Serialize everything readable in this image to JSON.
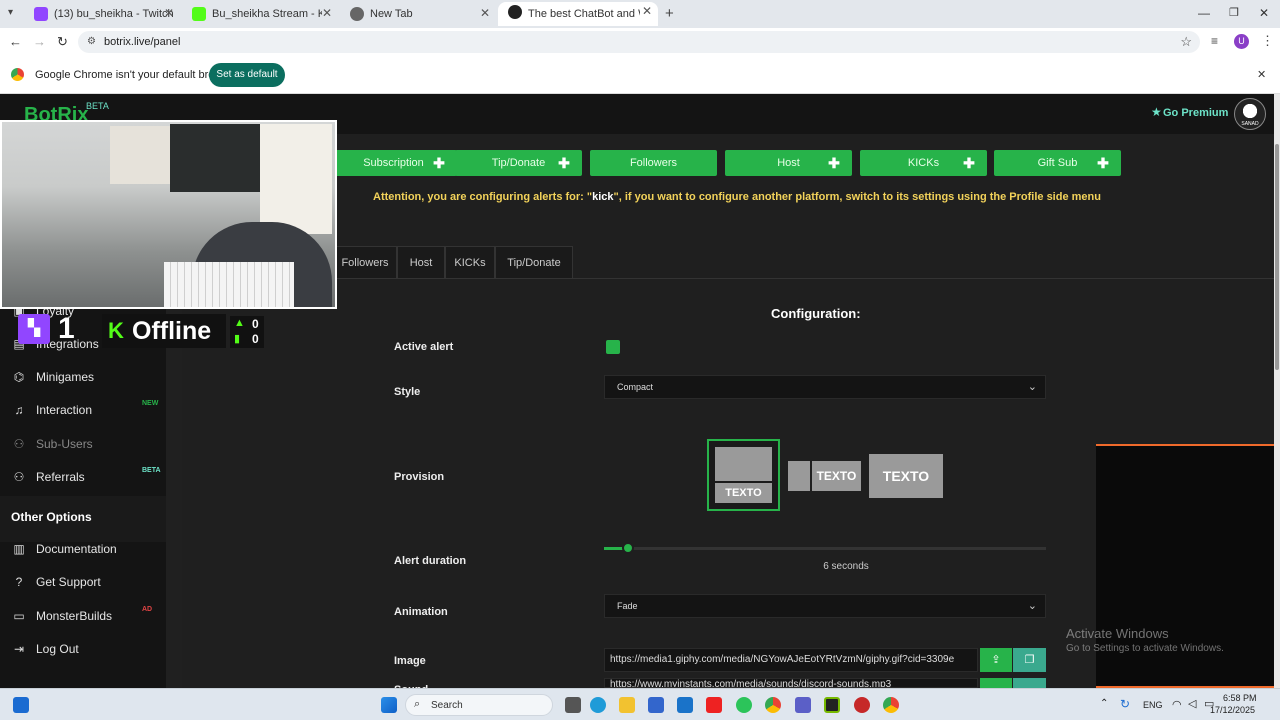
{
  "browser": {
    "tabs": [
      {
        "title": "(13) bu_sheikha - Twitch",
        "color": "#9146ff"
      },
      {
        "title": "Bu_sheikha Stream - Kick Dashb",
        "color": "#53fc18"
      },
      {
        "title": "New Tab",
        "color": "#666666"
      },
      {
        "title": "The best ChatBot and Widgets f",
        "color": "#222222"
      }
    ],
    "url": "botrix.live/panel",
    "infobar_text": "Google Chrome isn't your default browser",
    "infobar_button": "Set as default",
    "profile_initial": "U"
  },
  "app": {
    "logo": "BotRix",
    "logo_badge": "BETA",
    "premium": "Go Premium",
    "avatar_label": "SANAD",
    "alert_buttons": [
      "Subscription",
      "Tip/Donate",
      "Followers",
      "Host",
      "KICKs",
      "Gift Sub"
    ],
    "attention_prefix": "Attention, you are configuring alerts for: \"",
    "attention_platform": "kick",
    "attention_suffix": "\", if you want to configure another platform, switch to its settings using the Profile side menu",
    "subtabs": [
      "Followers",
      "Host",
      "KICKs",
      "Tip/Donate"
    ],
    "config_title": "Configuration:",
    "active_alert_label": "Active alert",
    "style_label": "Style",
    "style_value": "Compact",
    "provision_label": "Provision",
    "provision_text": "TEXTO",
    "alert_duration_label": "Alert duration",
    "alert_duration_value": "6",
    "alert_duration_unit": "seconds",
    "alert_duration_fraction": 0.04,
    "animation_label": "Animation",
    "animation_value": "Fade",
    "image_label": "Image",
    "image_url": "https://media1.giphy.com/media/NGYowAJeEotYRtVzmN/giphy.gif?cid=3309e",
    "sound_label": "Sound",
    "sound_url": "https://www.myinstants.com/media/sounds/discord-sounds.mp3"
  },
  "sidebar": {
    "partial_item": "Loyalty",
    "items": [
      {
        "label": "Integrations",
        "icon": "integrations-icon"
      },
      {
        "label": "Minigames",
        "icon": "gamepad-icon"
      },
      {
        "label": "Interaction",
        "icon": "music-icon",
        "badge": "NEW"
      },
      {
        "label": "Sub-Users",
        "icon": "users-icon"
      },
      {
        "label": "Referrals",
        "icon": "users-icon",
        "badge": "BETA"
      }
    ],
    "section_title": "Other Options",
    "other_items": [
      {
        "label": "Documentation",
        "icon": "book-icon"
      },
      {
        "label": "Get Support",
        "icon": "question-icon"
      },
      {
        "label": "MonsterBuilds",
        "icon": "laptop-icon",
        "badge": "AD"
      },
      {
        "label": "Log Out",
        "icon": "logout-icon"
      }
    ]
  },
  "overlay": {
    "twitch_count": "1",
    "kick_status": "Offline",
    "stat_up": "0",
    "stat_down": "0"
  },
  "watermark": {
    "title": "Activate Windows",
    "subtitle": "Go to Settings to activate Windows."
  },
  "taskbar": {
    "search": "Search",
    "lang": "ENG",
    "time": "6:58 PM",
    "date": "17/12/2025"
  },
  "colors": {
    "accent": "#27b34a",
    "attention": "#f2d25a",
    "premium": "#6de3c8"
  }
}
